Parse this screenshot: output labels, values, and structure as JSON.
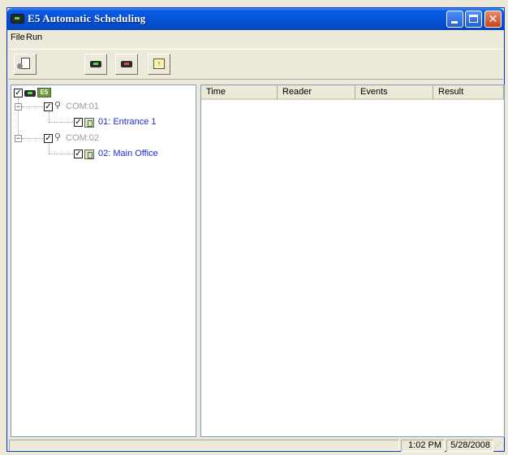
{
  "window": {
    "title": "E5 Automatic Scheduling"
  },
  "menu": {
    "file": "File",
    "run": "Run"
  },
  "toolbar": {
    "upload_glyph": "↑"
  },
  "tree": {
    "root_label": "E5",
    "ports": [
      {
        "name": "COM:01",
        "readers": [
          {
            "name": "01: Entrance 1"
          }
        ]
      },
      {
        "name": "COM:02",
        "readers": [
          {
            "name": "02: Main Office"
          }
        ]
      }
    ]
  },
  "events_table": {
    "columns": [
      "Time",
      "Reader",
      "Events",
      "Result"
    ],
    "rows": []
  },
  "statusbar": {
    "time": "1:02 PM",
    "date": "5/28/2008"
  },
  "icons": {
    "app": "reader-icon",
    "settings": "document-settings-icon",
    "start": "reader-green-icon",
    "stop": "reader-red-icon",
    "upload": "upload-icon"
  }
}
